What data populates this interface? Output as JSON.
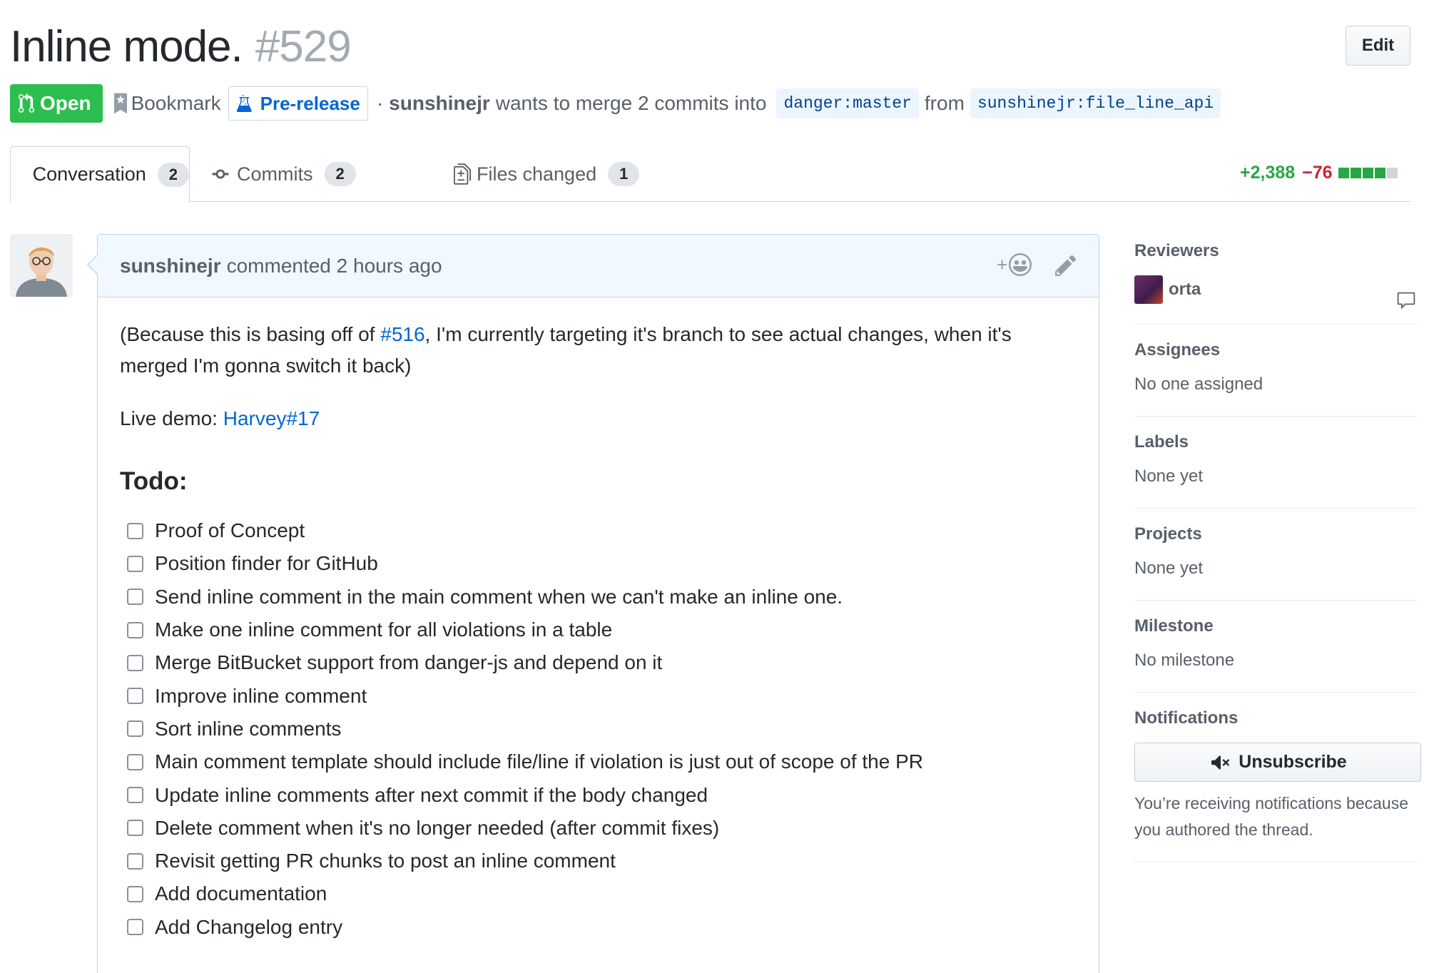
{
  "header": {
    "title": "Inline mode.",
    "number": "#529",
    "edit_label": "Edit"
  },
  "meta": {
    "state": "Open",
    "bookmark": "Bookmark",
    "label": "Pre-release",
    "separator": "·",
    "author": "sunshinejr",
    "action": "wants to merge 2 commits into",
    "base_branch": "danger:master",
    "from": "from",
    "head_branch": "sunshinejr:file_line_api"
  },
  "tabs": [
    {
      "label": "Conversation",
      "count": "2"
    },
    {
      "label": "Commits",
      "count": "2"
    },
    {
      "label": "Files changed",
      "count": "1"
    }
  ],
  "diffstat": {
    "additions": "+2,388",
    "deletions": "−76",
    "blocks": 5,
    "green_blocks": 4
  },
  "comment": {
    "author": "sunshinejr",
    "action_time": "commented 2 hours ago",
    "reaction_plus": "+",
    "p1_before": "(Because this is basing off of ",
    "p1_link": "#516",
    "p1_after": ", I'm currently targeting it's branch to see actual changes, when it's merged I'm gonna switch it back)",
    "demo_label": "Live demo: ",
    "demo_link": "Harvey#17",
    "todo_heading": "Todo:",
    "tasks": [
      "Proof of Concept",
      "Position finder for GitHub",
      "Send inline comment in the main comment when we can't make an inline one.",
      "Make one inline comment for all violations in a table",
      "Merge BitBucket support from danger-js and depend on it",
      "Improve inline comment",
      "Sort inline comments",
      "Main comment template should include file/line if violation is just out of scope of the PR",
      "Update inline comments after next commit if the body changed",
      "Delete comment when it's no longer needed (after commit fixes)",
      "Revisit getting PR chunks to post an inline comment",
      "Add documentation",
      "Add Changelog entry"
    ]
  },
  "sidebar": {
    "reviewers_heading": "Reviewers",
    "reviewer": "orta",
    "assignees_heading": "Assignees",
    "assignees_value": "No one assigned",
    "labels_heading": "Labels",
    "labels_value": "None yet",
    "projects_heading": "Projects",
    "projects_value": "None yet",
    "milestone_heading": "Milestone",
    "milestone_value": "No milestone",
    "notifications_heading": "Notifications",
    "unsubscribe_label": "Unsubscribe",
    "notif_reason": "You’re receiving notifications because you authored the thread."
  },
  "colors": {
    "open_green": "#2cbe4e",
    "link_blue": "#0366d6",
    "addition_green": "#28a745",
    "deletion_red": "#cb2431"
  }
}
